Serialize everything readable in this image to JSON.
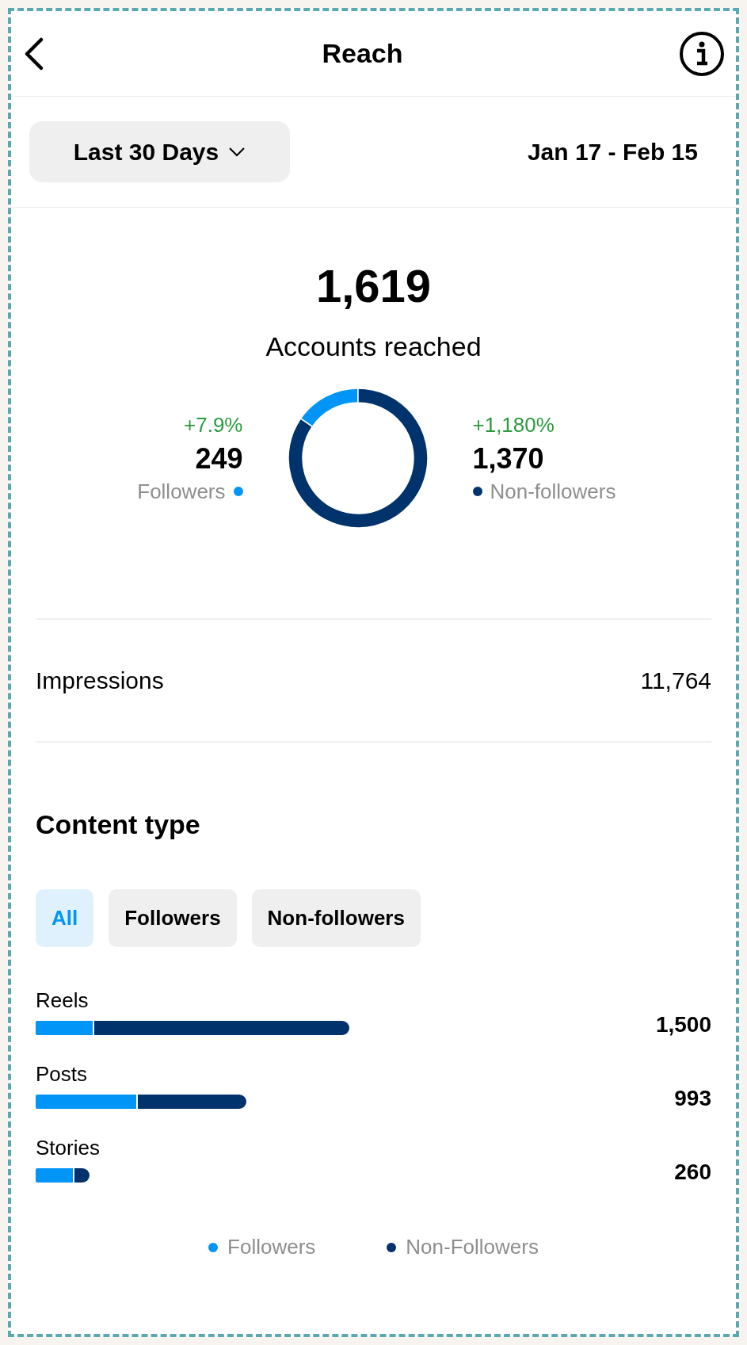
{
  "header": {
    "title": "Reach"
  },
  "filter": {
    "range": "Last 30 Days",
    "dates": "Jan 17 - Feb 15"
  },
  "summary": {
    "total": "1,619",
    "label": "Accounts reached",
    "stats": [
      {
        "change": "+7.9%",
        "value": "249",
        "label": "Followers",
        "color": "#0095f6"
      },
      {
        "change": "+1,180%",
        "value": "1,370",
        "label": "Non-followers",
        "color": "#00336b"
      }
    ],
    "chart_data": {
      "type": "donut",
      "values": [
        15.4,
        84.6
      ]
    }
  },
  "impressions": {
    "label": "Impressions",
    "value": "11,764"
  },
  "content_type": {
    "title": "Content type",
    "tabs": [
      {
        "label": "All",
        "selected": true
      },
      {
        "label": "Followers",
        "selected": false
      },
      {
        "label": "Non-followers",
        "selected": false
      }
    ],
    "rows": [
      {
        "label": "Reels",
        "value": "1,500"
      },
      {
        "label": "Posts",
        "value": "993"
      },
      {
        "label": "Stories",
        "value": "260"
      }
    ],
    "legend": [
      {
        "label": "Followers",
        "color": "#0095f6"
      },
      {
        "label": "Non-Followers",
        "color": "#00336b"
      }
    ]
  }
}
